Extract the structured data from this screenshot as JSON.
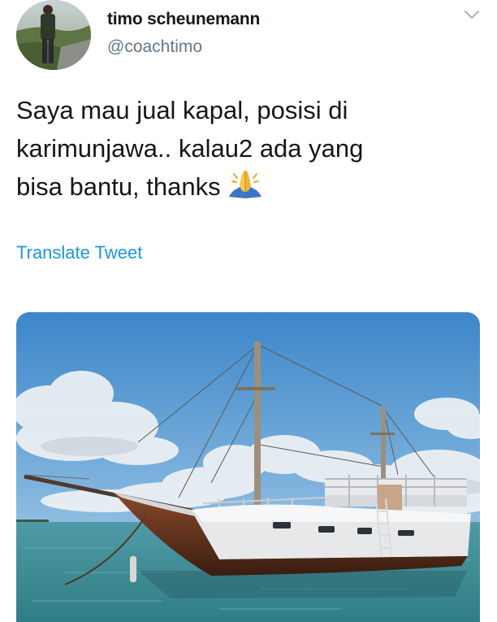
{
  "user": {
    "display_name": "timo scheunemann",
    "handle": "@coachtimo"
  },
  "tweet": {
    "lines": [
      "Saya mau jual kapal, posisi di",
      "karimunjawa.. kalau2 ada yang",
      "bisa bantu, thanks"
    ],
    "emoji": "folded-hands",
    "translate_label": "Translate Tweet"
  },
  "icons": {
    "menu": "chevron-down-icon"
  },
  "colors": {
    "link": "#1b95e0",
    "handle": "#657786",
    "text": "#14171a"
  }
}
